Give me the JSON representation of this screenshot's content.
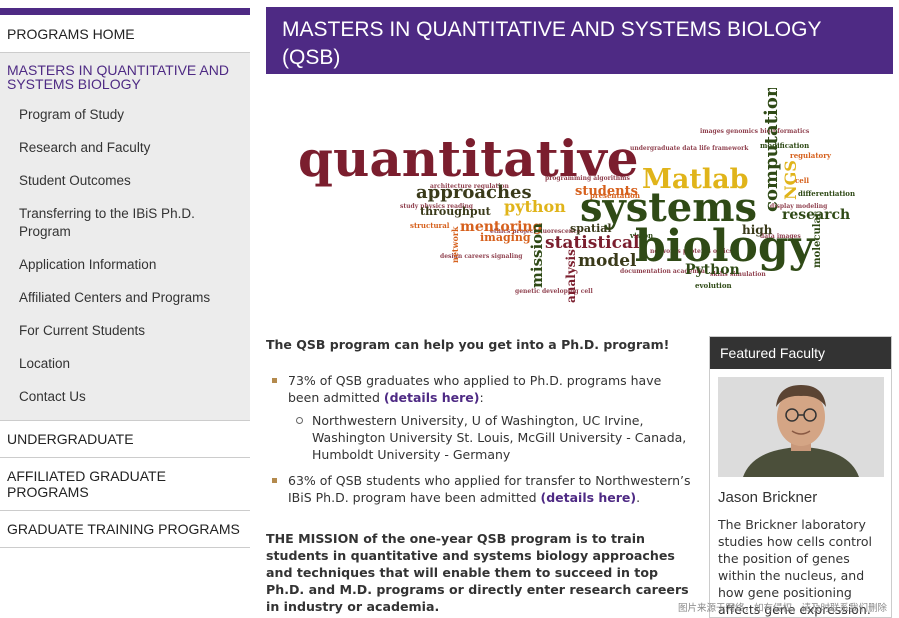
{
  "sidebar": {
    "home": "PROGRAMS HOME",
    "section_title": "MASTERS IN QUANTITATIVE AND SYSTEMS BIOLOGY",
    "items": [
      {
        "label": "Program of Study"
      },
      {
        "label": "Research and Faculty"
      },
      {
        "label": "Student Outcomes"
      },
      {
        "label": "Transferring to the IBiS Ph.D. Program"
      },
      {
        "label": "Application Information"
      },
      {
        "label": "Affiliated Centers and Programs"
      },
      {
        "label": "For Current Students"
      },
      {
        "label": "Location"
      },
      {
        "label": "Contact Us"
      }
    ],
    "undergraduate": "UNDERGRADUATE",
    "affiliated": "AFFILIATED GRADUATE PROGRAMS",
    "training": "GRADUATE TRAINING PROGRAMS"
  },
  "page": {
    "title": "MASTERS IN QUANTITATIVE AND SYSTEMS BIOLOGY (QSB)"
  },
  "wordcloud": {
    "words": {
      "quantitative": "quantitative",
      "systems": "systems",
      "biology": "biology",
      "matlab": "Matlab",
      "computational": "computational",
      "ngs": "NGS",
      "approaches": "approaches",
      "python_small": "python",
      "python": "Python",
      "mission": "mission",
      "statistical": "statistical",
      "model": "model",
      "analysis": "analysis",
      "mentoring": "mentoring",
      "throughput": "throughput",
      "students": "students",
      "research": "research",
      "imaging": "imaging",
      "high": "high",
      "molecular": "molecular",
      "spatial": "spatial",
      "network": "network"
    },
    "colors": {
      "maroon": "#7b1e2e",
      "olive": "#2f4a16",
      "gold": "#e0b41a",
      "orange": "#d6601c",
      "dark": "#3a3a1a"
    }
  },
  "content": {
    "lead": "The QSB program can help you get into a Ph.D. program!",
    "stat1_text": "73% of QSB graduates who applied to Ph.D. programs have been admitted ",
    "stat1_link": "(details here)",
    "stat1_tail": ":",
    "schools": "Northwestern University, U of Washington, UC Irvine, Washington University St. Louis, McGill University - Canada, Humboldt University - Germany",
    "stat2_text": "63% of QSB students who applied for transfer to Northwestern’s IBiS Ph.D. program have been admitted ",
    "stat2_link": "(details here)",
    "stat2_tail": ".",
    "mission": "THE MISSION of the one-year QSB program is to train students in quantitative and systems biology approaches and techniques that will enable them to succeed in top Ph.D. and M.D. programs or directly enter research careers in industry or academia."
  },
  "featured": {
    "heading": "Featured Faculty",
    "name": "Jason Brickner",
    "description": "The Brickner laboratory studies how cells control the position of genes within the nucleus, and how gene positioning affects gene expression."
  },
  "watermark": "图片来源于网络，如有侵权，请及时联系我们删除"
}
